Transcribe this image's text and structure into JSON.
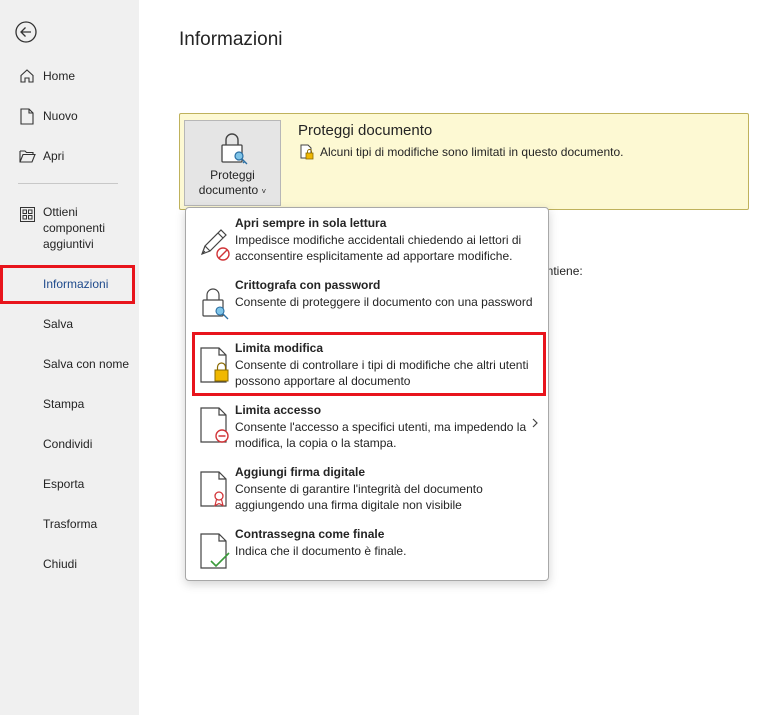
{
  "sidebar": {
    "back_icon": "arrow-left-circle-icon",
    "items": [
      {
        "label": "Home",
        "icon": "home-icon"
      },
      {
        "label": "Nuovo",
        "icon": "new-document-icon"
      },
      {
        "label": "Apri",
        "icon": "folder-open-icon"
      },
      {
        "label": "Ottieni componenti aggiuntivi",
        "icon": "grid-addins-icon"
      },
      {
        "label": "Informazioni"
      },
      {
        "label": "Salva"
      },
      {
        "label": "Salva con nome"
      },
      {
        "label": "Stampa"
      },
      {
        "label": "Condividi"
      },
      {
        "label": "Esporta"
      },
      {
        "label": "Trasforma"
      },
      {
        "label": "Chiudi"
      }
    ],
    "active": "Informazioni"
  },
  "main": {
    "title": "Informazioni",
    "protect": {
      "button_line1": "Proteggi",
      "button_line2": "documento",
      "card_title": "Proteggi documento",
      "card_desc": "Alcuni tipi di modifiche sono limitati in questo documento."
    },
    "partial_text": "ontiene:"
  },
  "menu": {
    "items": [
      {
        "title": "Apri sempre in sola lettura",
        "desc": "Impedisce modifiche accidentali chiedendo ai lettori di acconsentire esplicitamente ad apportare modifiche.",
        "icon": "pencil-no-edit-icon"
      },
      {
        "title": "Crittografa con password",
        "desc": "Consente di proteggere il documento con una password",
        "icon": "lock-key-icon"
      },
      {
        "title": "Limita modifica",
        "desc": "Consente di controllare i tipi di modifiche che altri utenti possono apportare al documento",
        "icon": "document-lock-icon"
      },
      {
        "title": "Limita accesso",
        "desc": "Consente l'accesso a specifici utenti, ma impedendo la modifica, la copia o la stampa.",
        "icon": "document-restrict-icon"
      },
      {
        "title": "Aggiungi firma digitale",
        "desc": "Consente di garantire l'integrità del documento aggiungendo una firma digitale non visibile",
        "icon": "document-signature-icon"
      },
      {
        "title": "Contrassegna come finale",
        "desc": "Indica che il documento è finale.",
        "icon": "document-final-check-icon"
      }
    ],
    "highlighted": "Limita modifica"
  },
  "colors": {
    "highlight_red": "#e8141c",
    "card_yellow": "#fdf9d3",
    "sidebar_bg": "#f0f0f0",
    "active_blue": "#1e4a8c"
  }
}
